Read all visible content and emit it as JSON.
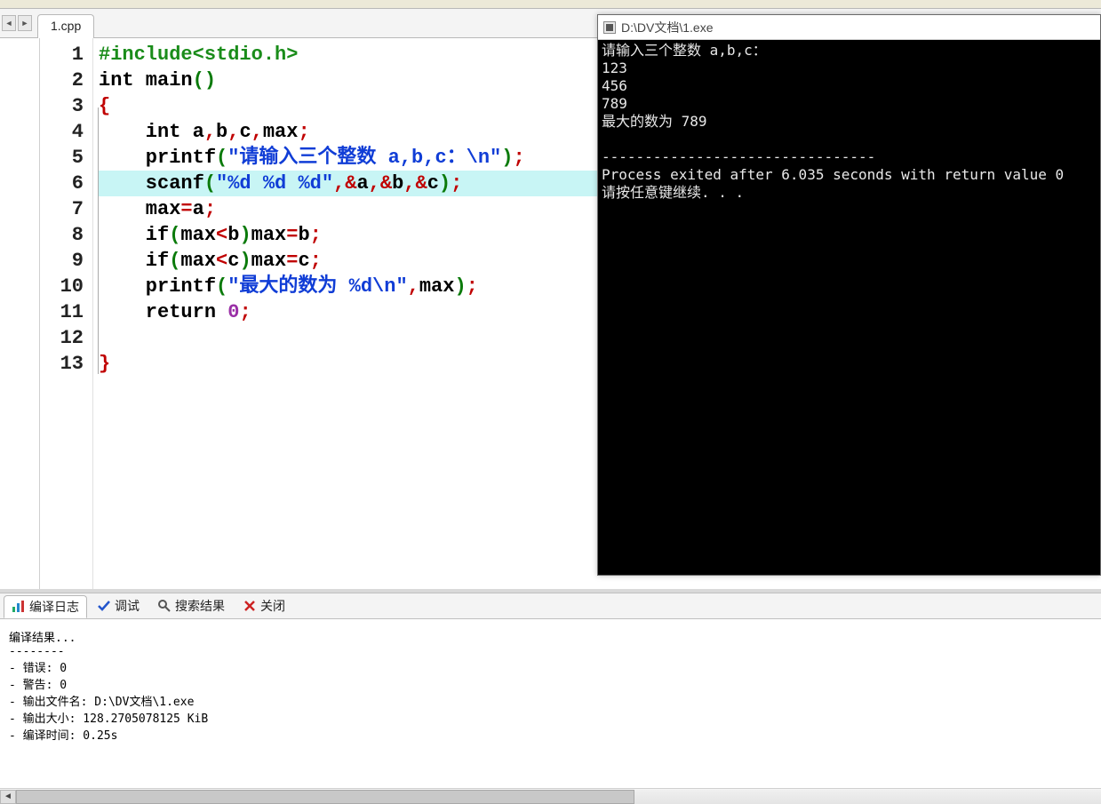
{
  "tabs": {
    "file_tab": "1.cpp"
  },
  "editor": {
    "line_numbers": [
      "1",
      "2",
      "3",
      "4",
      "5",
      "6",
      "7",
      "8",
      "9",
      "10",
      "11",
      "12",
      "13"
    ],
    "highlighted_line_index": 5,
    "fold_box_line_index": 2,
    "code": {
      "l1_include": "#include<stdio.h>",
      "l2_a": "int",
      "l2_b": " main",
      "l2_c": "()",
      "l3_brace": "{",
      "l4_a": "    int",
      "l4_b": " a",
      "l4_c": ",",
      "l4_d": "b",
      "l4_e": ",",
      "l4_f": "c",
      "l4_g": ",",
      "l4_h": "max",
      "l4_i": ";",
      "l5_a": "    printf",
      "l5_b": "(",
      "l5_c": "\"请输入三个整数 a,b,c：\\n\"",
      "l5_d": ")",
      "l5_e": ";",
      "l6_a": "    scanf",
      "l6_b": "(",
      "l6_c": "\"%d %d %d\"",
      "l6_d": ",",
      "l6_e": "&",
      "l6_f": "a",
      "l6_g": ",",
      "l6_h": "&",
      "l6_i": "b",
      "l6_j": ",",
      "l6_k": "&",
      "l6_l": "c",
      "l6_m": ")",
      "l6_n": ";",
      "l7_a": "    max",
      "l7_b": "=",
      "l7_c": "a",
      "l7_d": ";",
      "l8_a": "    if",
      "l8_b": "(",
      "l8_c": "max",
      "l8_d": "<",
      "l8_e": "b",
      "l8_f": ")",
      "l8_g": "max",
      "l8_h": "=",
      "l8_i": "b",
      "l8_j": ";",
      "l9_a": "    if",
      "l9_b": "(",
      "l9_c": "max",
      "l9_d": "<",
      "l9_e": "c",
      "l9_f": ")",
      "l9_g": "max",
      "l9_h": "=",
      "l9_i": "c",
      "l9_j": ";",
      "l10_a": "    printf",
      "l10_b": "(",
      "l10_c": "\"最大的数为 %d\\n\"",
      "l10_d": ",",
      "l10_e": "max",
      "l10_f": ")",
      "l10_g": ";",
      "l11_a": "    return",
      "l11_b": " ",
      "l11_c": "0",
      "l11_d": ";",
      "l13_brace": "}"
    }
  },
  "console": {
    "title": "D:\\DV文档\\1.exe",
    "lines": [
      "请输入三个整数 a,b,c：",
      "123",
      "456",
      "789",
      "最大的数为 789",
      "",
      "--------------------------------",
      "Process exited after 6.035 seconds with return value 0",
      "请按任意键继续. . ."
    ]
  },
  "bottom": {
    "tabs": {
      "compile_log": "编译日志",
      "debug": "调试",
      "search_results": "搜索结果",
      "close": "关闭"
    },
    "body_lines": [
      "编译结果...",
      "--------",
      "- 错误: 0",
      "- 警告: 0",
      "- 输出文件名: D:\\DV文档\\1.exe",
      "- 输出大小: 128.2705078125 KiB",
      "- 编译时间: 0.25s"
    ],
    "scroll_thumb_percent": 57
  }
}
